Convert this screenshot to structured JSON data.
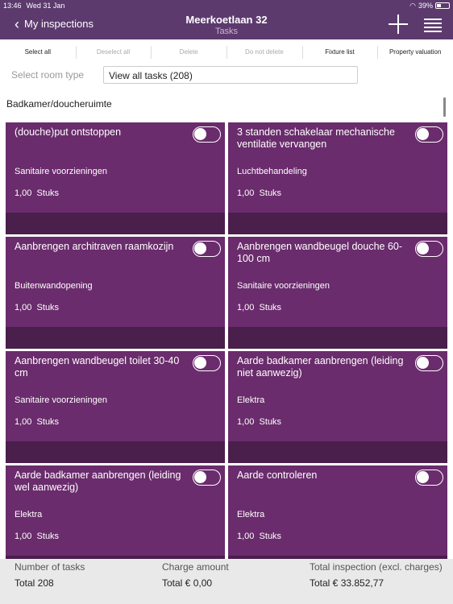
{
  "status_bar": {
    "time": "13:46",
    "date": "Wed 31 Jan",
    "battery": "39%",
    "battery_level": 0.39
  },
  "nav": {
    "back_label": "My inspections",
    "title": "Meerkoetlaan 32",
    "subtitle": "Tasks",
    "icons": [
      "plus-icon",
      "list-icon"
    ]
  },
  "toolbar": {
    "select_all": "Select all",
    "deselect_all": "Deselect all",
    "delete": "Delete",
    "do_not_delete": "Do not delete",
    "fixture_list": "Fixture list",
    "property_valuation": "Property valuation"
  },
  "filter": {
    "label": "Select room type",
    "value": "View all tasks (208)"
  },
  "section": {
    "title": "Badkamer/doucheruimte"
  },
  "tasks": [
    {
      "title": "(douche)put ontstoppen",
      "category": "Sanitaire voorzieningen",
      "quantity": "1,00",
      "unit": "Stuks"
    },
    {
      "title": "3 standen schakelaar mechanische ventilatie vervangen",
      "category": "Luchtbehandeling",
      "quantity": "1,00",
      "unit": "Stuks"
    },
    {
      "title": "Aanbrengen architraven raamkozijn",
      "category": "Buitenwandopening",
      "quantity": "1,00",
      "unit": "Stuks"
    },
    {
      "title": "Aanbrengen wandbeugel douche 60-100 cm",
      "category": "Sanitaire voorzieningen",
      "quantity": "1,00",
      "unit": "Stuks"
    },
    {
      "title": "Aanbrengen wandbeugel toilet 30-40 cm",
      "category": "Sanitaire voorzieningen",
      "quantity": "1,00",
      "unit": "Stuks"
    },
    {
      "title": "Aarde badkamer aanbrengen (leiding niet aanwezig)",
      "category": "Elektra",
      "quantity": "1,00",
      "unit": "Stuks"
    },
    {
      "title": "Aarde badkamer aanbrengen (leiding wel aanwezig)",
      "category": "Elektra",
      "quantity": "1,00",
      "unit": "Stuks"
    },
    {
      "title": "Aarde controleren",
      "category": "Elektra",
      "quantity": "1,00",
      "unit": "Stuks"
    }
  ],
  "summary": {
    "number_label": "Number of tasks",
    "number_value": "Total  208",
    "charge_label": "Charge amount",
    "charge_value": "Total  € 0,00",
    "total_label": "Total inspection (excl. charges)",
    "total_value": "Total  € 33.852,77"
  },
  "colors": {
    "header": "#5c3a6e",
    "card": "#6a2c6c",
    "card_footer": "#4a1f4c"
  }
}
